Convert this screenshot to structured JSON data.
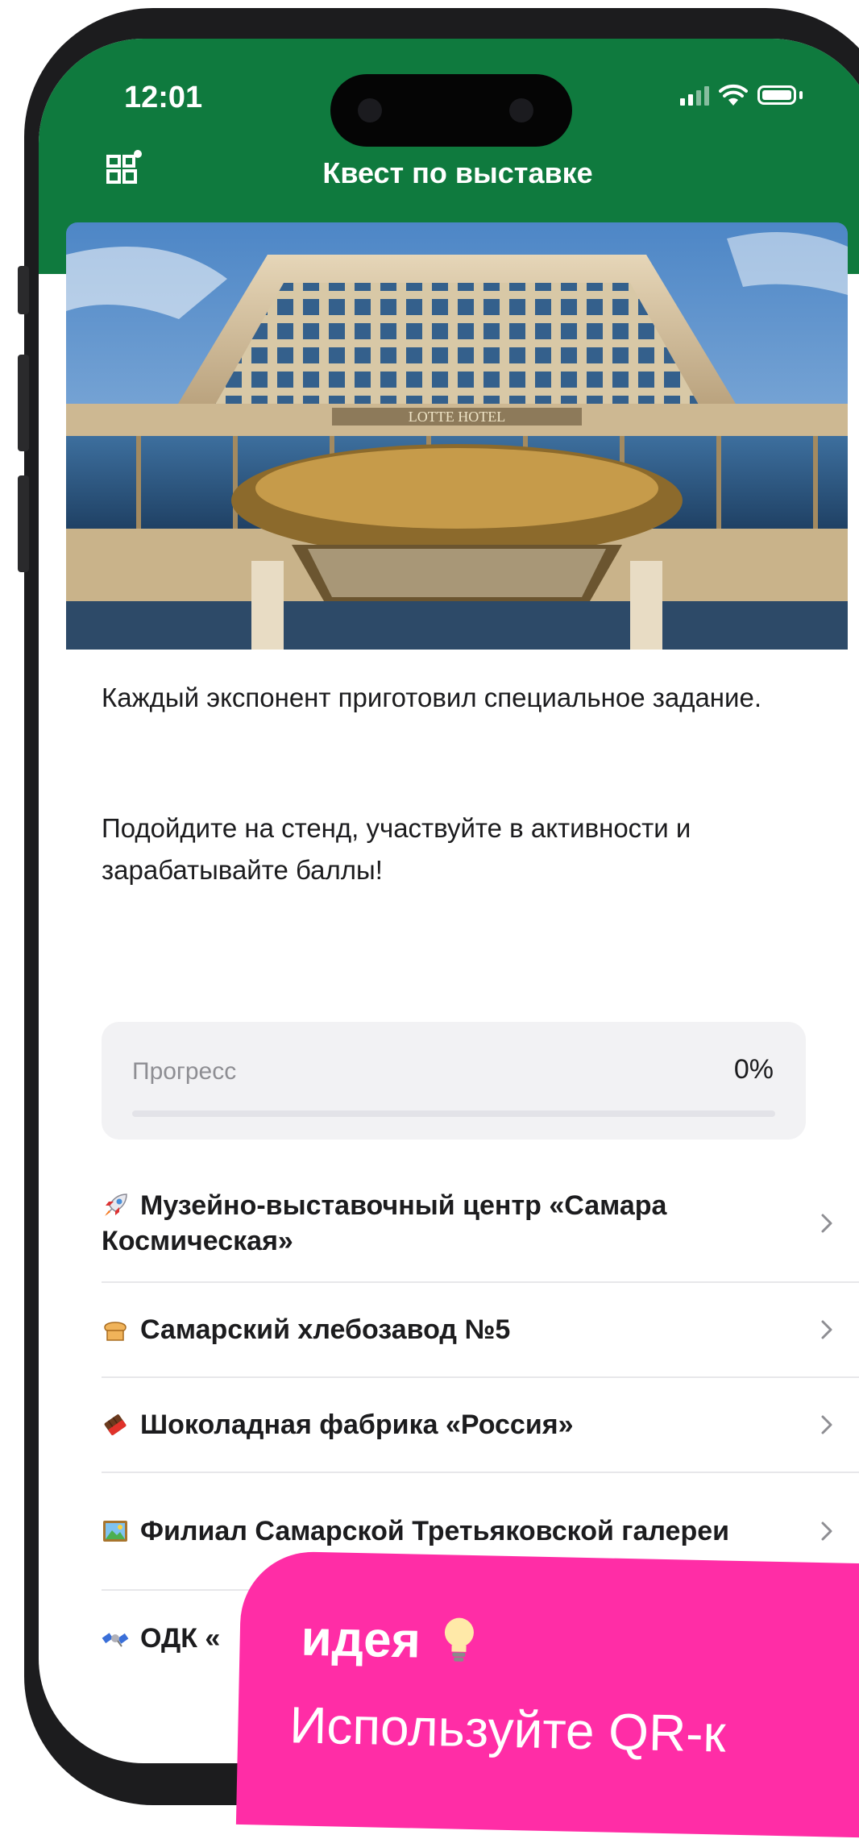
{
  "status_bar": {
    "time": "12:01"
  },
  "header": {
    "title": "Квест по выставке",
    "background_color": "#0f7a3e",
    "qr_icon": "qr-code-icon"
  },
  "hero": {
    "sign_text": "LOTTE HOTEL"
  },
  "description": {
    "paragraph_1": "Каждый экспонент приготовил специальное задание.",
    "paragraph_2": "Подойдите на стенд, участвуйте в активности и зарабатывайте баллы!"
  },
  "progress": {
    "label": "Прогресс",
    "value_text": "0%",
    "value": 0
  },
  "stands": [
    {
      "emoji": "rocket-icon",
      "label": "Музейно-выставочный центр «Самара Космическая»"
    },
    {
      "emoji": "bread-icon",
      "label": "Самарский хлебозавод №5"
    },
    {
      "emoji": "chocolate-icon",
      "label": "Шоколадная фабрика «Россия»"
    },
    {
      "emoji": "framed-picture-icon",
      "label": "Филиал Самарской Третьяковской галереи"
    },
    {
      "emoji": "satellite-icon",
      "label": "ОДК «"
    }
  ],
  "idea_banner": {
    "title": "идея",
    "text": "Используйте QR-к",
    "icon": "light-bulb-icon",
    "color": "#ff2da6"
  }
}
